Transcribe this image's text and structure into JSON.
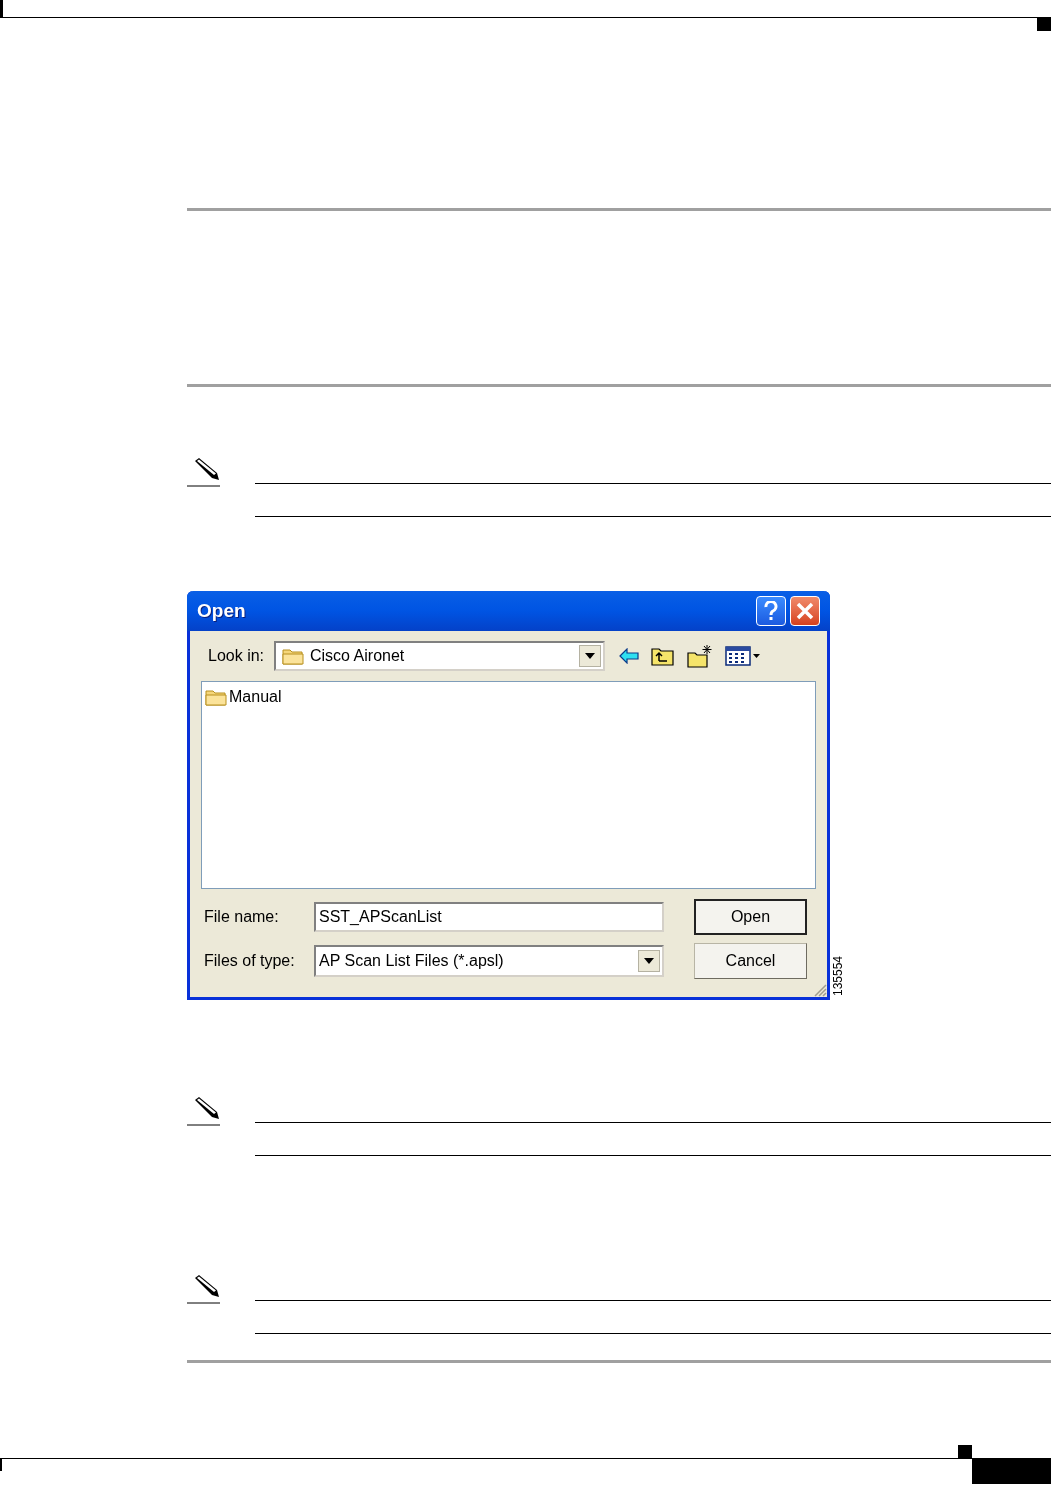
{
  "dialog": {
    "title": "Open",
    "look_in": {
      "label": "Look in:",
      "value": "Cisco Aironet"
    },
    "items": [
      {
        "name": "Manual"
      }
    ],
    "file_name": {
      "label": "File name:",
      "value": "SST_APScanList"
    },
    "files_of_type": {
      "label": "Files of type:",
      "value": "AP Scan List Files (*.apsl)"
    },
    "buttons": [
      {
        "label": "Open",
        "default": true
      },
      {
        "label": "Cancel",
        "default": false
      }
    ]
  },
  "figure_number": "135554"
}
